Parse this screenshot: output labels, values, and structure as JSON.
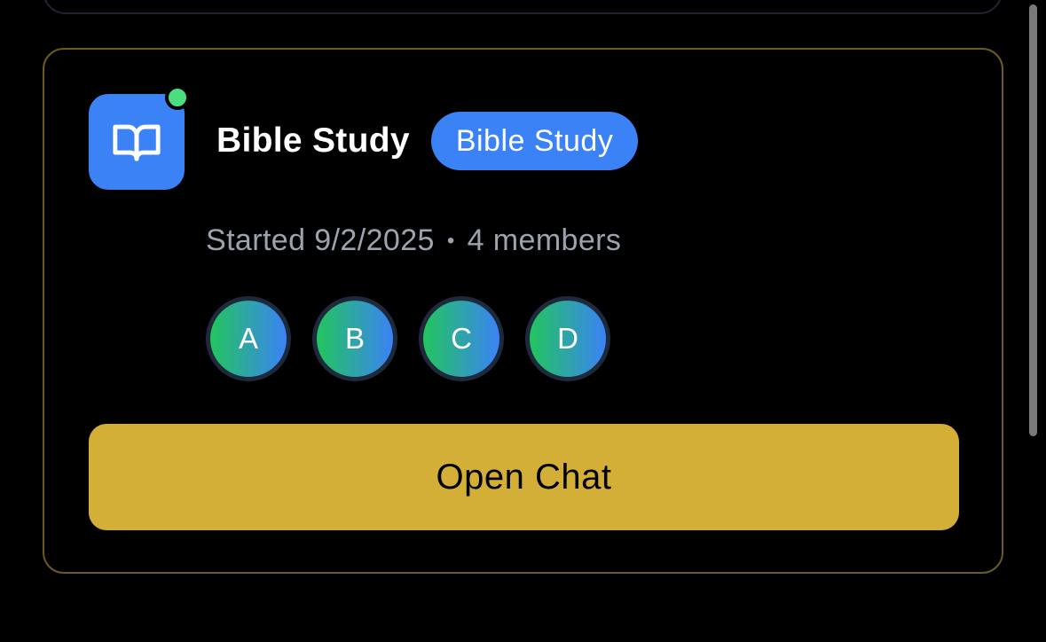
{
  "group": {
    "title": "Bible Study",
    "category_badge": "Bible Study",
    "icon": "open-book-icon",
    "online": true,
    "meta": {
      "started": "Started 9/2/2025",
      "separator": "•",
      "members": "4 members"
    },
    "member_avatars": [
      "A",
      "B",
      "C",
      "D"
    ],
    "open_chat_label": "Open Chat"
  },
  "colors": {
    "accent_gold": "#d4af37",
    "icon_blue": "#3b82f6",
    "online_green": "#4ade80",
    "card_border": "#6b5a23",
    "avatar_gradient_start": "#22c55e",
    "avatar_gradient_end": "#3b82f6"
  }
}
